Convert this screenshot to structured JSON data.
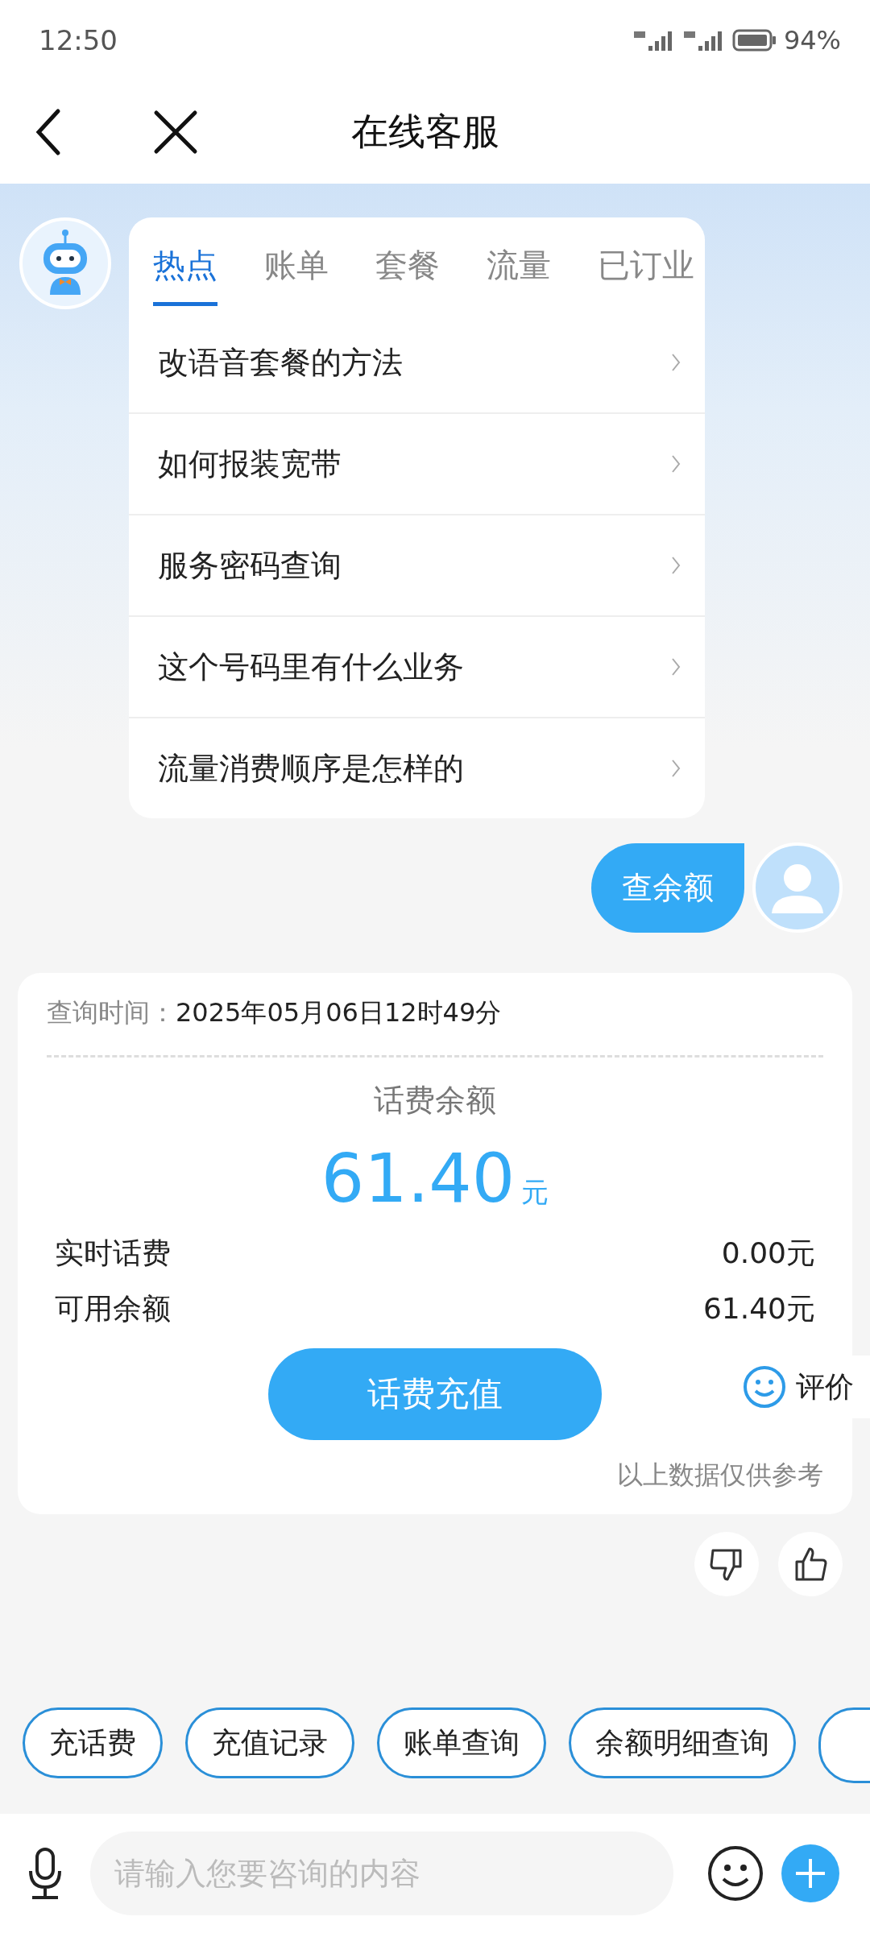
{
  "status_bar": {
    "time": "12:50",
    "battery": "94%"
  },
  "header": {
    "title": "在线客服"
  },
  "hot_card": {
    "tabs": [
      {
        "label": "热点",
        "selected": true
      },
      {
        "label": "账单",
        "selected": false
      },
      {
        "label": "套餐",
        "selected": false
      },
      {
        "label": "流量",
        "selected": false
      },
      {
        "label": "已订业",
        "selected": false
      }
    ],
    "items": [
      "改语音套餐的方法",
      "如何报装宽带",
      "服务密码查询",
      "这个号码里有什么业务",
      "流量消费顺序是怎样的"
    ]
  },
  "user_message": "查余额",
  "balance_card": {
    "query_label": "查询时间：",
    "query_time": "2025年05月06日12时49分",
    "title": "话费余额",
    "amount": "61.40",
    "unit": "元",
    "rows": [
      {
        "label": "实时话费",
        "value": "0.00元"
      },
      {
        "label": "可用余额",
        "value": "61.40元"
      }
    ],
    "button": "话费充值",
    "note": "以上数据仅供参考"
  },
  "rate_button": "评价",
  "quick_chips": [
    "充话费",
    "充值记录",
    "账单查询",
    "余额明细查询"
  ],
  "input": {
    "placeholder": "请输入您要咨询的内容"
  }
}
